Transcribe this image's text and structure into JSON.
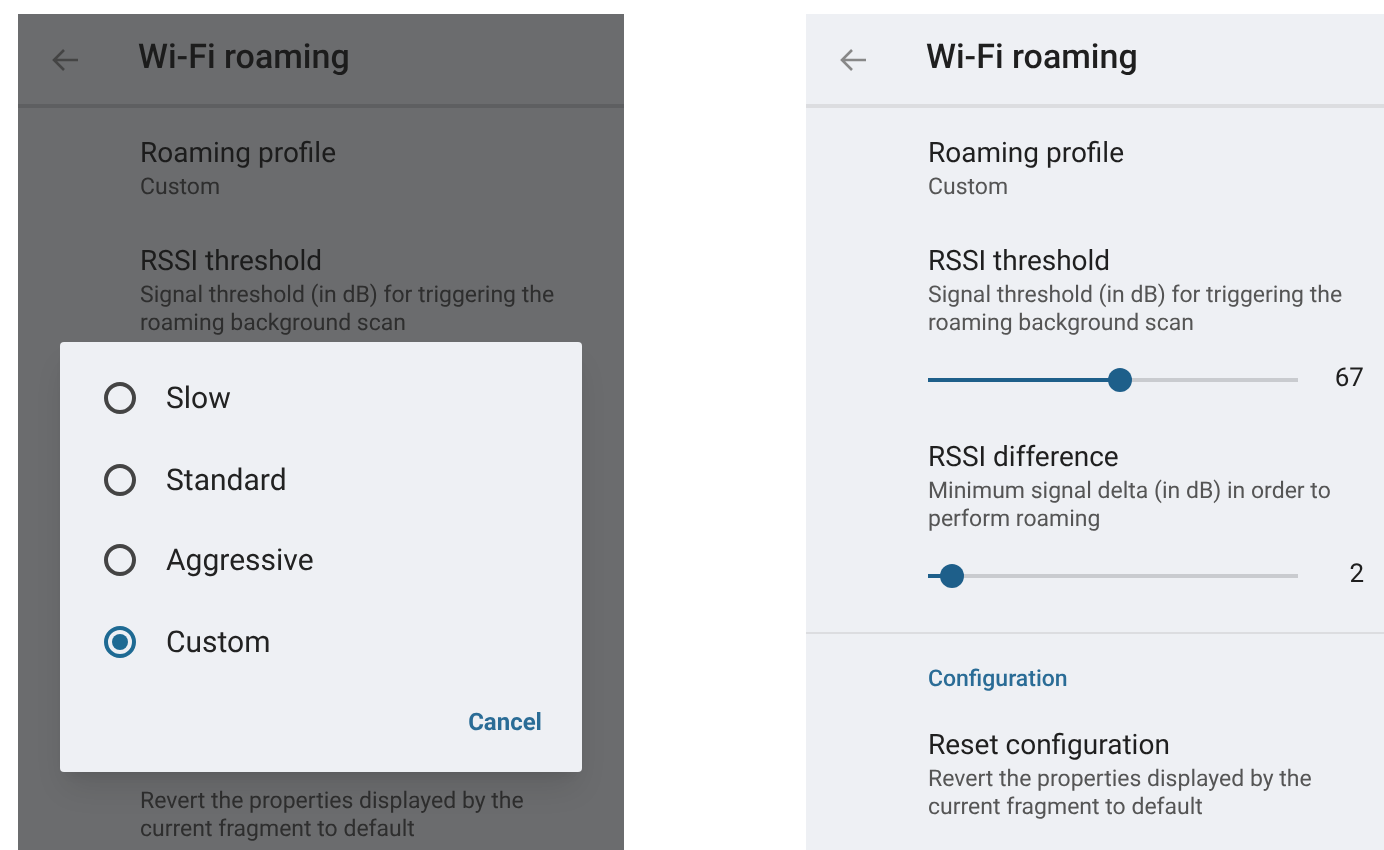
{
  "screens": [
    {
      "dimmed": true,
      "title": "Wi-Fi roaming",
      "items": [
        {
          "kind": "pref",
          "title": "Roaming profile",
          "summary": "Custom"
        },
        {
          "kind": "pref",
          "title": "RSSI threshold",
          "summary": "Signal threshold (in dB) for triggering the roaming background scan"
        }
      ],
      "footer": {
        "summary": "Revert the properties displayed by the current fragment to default"
      },
      "dialog": {
        "options": [
          {
            "label": "Slow",
            "selected": false
          },
          {
            "label": "Standard",
            "selected": false
          },
          {
            "label": "Aggressive",
            "selected": false
          },
          {
            "label": "Custom",
            "selected": true
          }
        ],
        "cancel": "Cancel"
      }
    },
    {
      "dimmed": false,
      "title": "Wi-Fi roaming",
      "items": [
        {
          "kind": "pref",
          "title": "Roaming profile",
          "summary": "Custom"
        },
        {
          "kind": "slider",
          "title": "RSSI threshold",
          "summary": "Signal threshold (in dB) for triggering the roaming background scan",
          "level": 0.52,
          "reading": "67"
        },
        {
          "kind": "slider",
          "title": "RSSI difference",
          "summary": "Minimum signal delta (in dB) in order to perform roaming",
          "level": 0.065,
          "reading": "2"
        },
        {
          "kind": "divider"
        },
        {
          "kind": "section",
          "title": "Configuration"
        },
        {
          "kind": "pref",
          "title": "Reset configuration",
          "summary": "Revert the properties displayed by the current fragment to default"
        }
      ]
    }
  ]
}
